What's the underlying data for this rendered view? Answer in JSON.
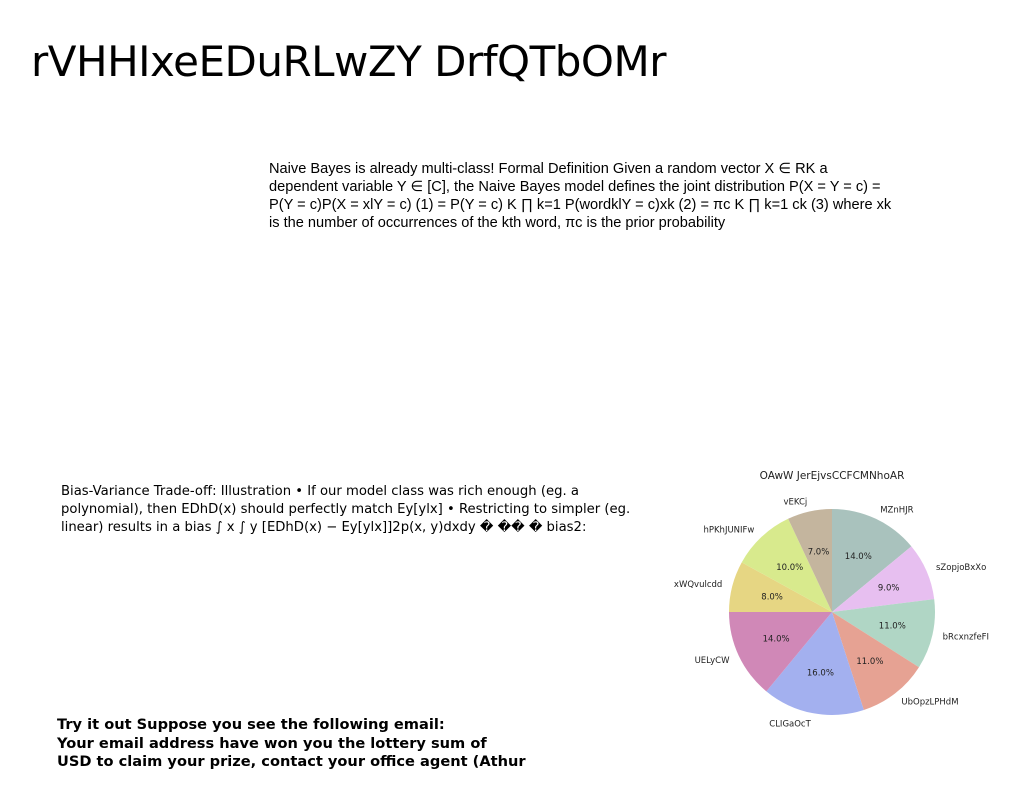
{
  "slide": {
    "title": "rVHHIxeEDuRLwZY DrfQTbOMr",
    "paragraph1": "Naive Bayes is already multi-class! Formal Definition Given a random vector X ∈ RK a dependent variable Y ∈ [C], the Naive Bayes model defines the joint distribution P(X = Y = c) = P(Y = c)P(X = xlY = c) (1) = P(Y = c) K ∏ k=1 P(wordklY = c)xk (2) = πc K ∏ k=1 ck (3) where xk is the number of occurrences of the kth word, πc is the prior probability",
    "paragraph2": "Bias-Variance Trade-off: Illustration • If our model class was rich enough (eg. a polynomial), then EDhD(x) should perfectly match Ey[ylx] • Restricting to simpler (eg. linear) results in a bias ∫ x ∫ y [EDhD(x) − Ey[ylx]]2p(x, y)dxdy � �� � bias2:",
    "email_lines": [
      "Try it out Suppose you see the following email:",
      "Your email address have won you the lottery sum of",
      "USD to claim your prize, contact your office agent (Athur"
    ]
  },
  "chart_data": {
    "type": "pie",
    "title": "OAwW JerEjvsCCFCMNhoAR",
    "labels": [
      "MZnHJR",
      "sZopjoBxXo",
      "bRcxnzfeFI",
      "UbOpzLPHdM",
      "CLIGaOcT",
      "UELyCW",
      "xWQvulcdd",
      "hPKhJUNIFw",
      "vEKCj"
    ],
    "values": [
      14.0,
      9.0,
      11.0,
      11.0,
      16.0,
      14.0,
      8.0,
      10.0,
      7.0
    ],
    "pct_labels": [
      "14.0%",
      "9.0%",
      "11.0%",
      "11.0%",
      "16.0%",
      "14.0%",
      "8.0%",
      "10.0%",
      "7.0%"
    ],
    "colors": [
      "#a9c2bd",
      "#e7bff0",
      "#b0d6c5",
      "#e6a293",
      "#a3b0ef",
      "#d088b7",
      "#e6d683",
      "#d8ea8d",
      "#c4b59e"
    ],
    "start_angle": 90,
    "direction": "clockwise"
  }
}
